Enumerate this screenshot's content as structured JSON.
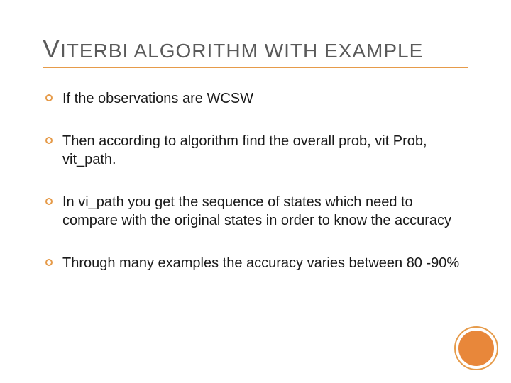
{
  "title": {
    "leading": "V",
    "rest": "ITERBI ALGORITHM WITH EXAMPLE"
  },
  "bullets": [
    "If the observations are WCSW",
    "Then according to algorithm find the overall prob, vit Prob, vit_path.",
    "In vi_path you get the sequence of states which need to compare with the original states in order to know the accuracy",
    "Through many examples the accuracy varies between 80 -90%"
  ]
}
